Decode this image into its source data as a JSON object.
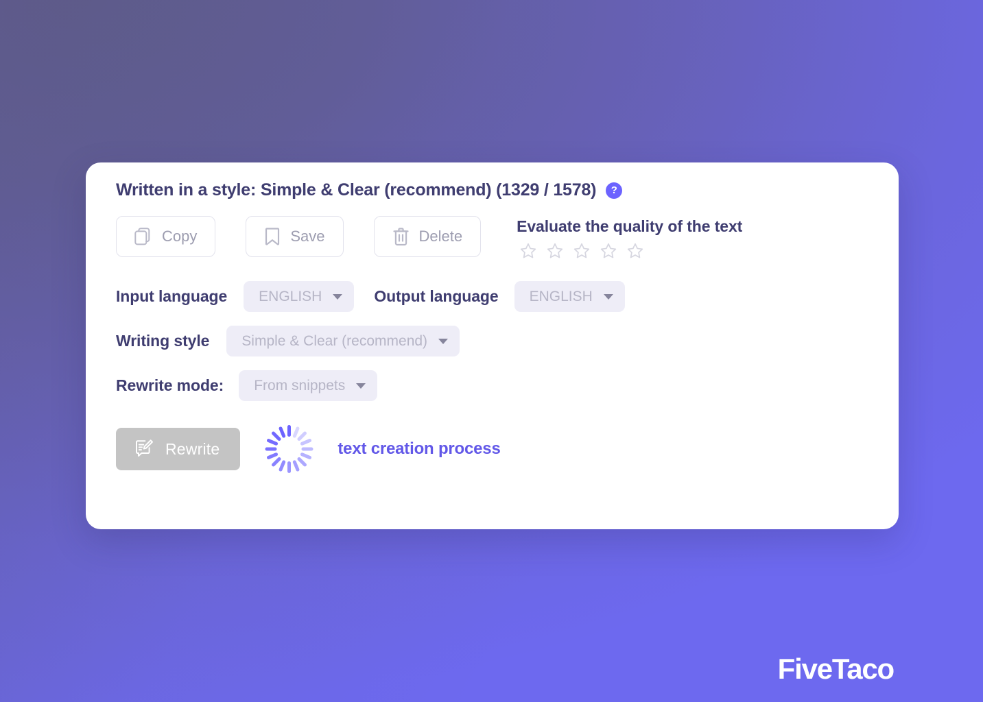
{
  "background": {
    "gradient_from": "#5e5b89",
    "gradient_to": "#6d69ef"
  },
  "card": {
    "heading": "Written in a style: Simple & Clear (recommend) (1329 / 1578)",
    "help_icon_glyph": "?",
    "accent_color": "#6c63ff",
    "heading_color": "#3f3d70"
  },
  "actions": [
    {
      "id": "copy",
      "label": "Copy",
      "icon": "copy-icon"
    },
    {
      "id": "save",
      "label": "Save",
      "icon": "bookmark-icon"
    },
    {
      "id": "delete",
      "label": "Delete",
      "icon": "trash-icon"
    }
  ],
  "evaluate": {
    "title": "Evaluate the quality of the text",
    "stars_total": 5,
    "stars_filled": 0,
    "star_color": "#d6d6e0"
  },
  "fields": {
    "input_language": {
      "label": "Input language",
      "value": "ENGLISH"
    },
    "output_language": {
      "label": "Output language",
      "value": "ENGLISH"
    },
    "writing_style": {
      "label": "Writing style",
      "value": "Simple & Clear (recommend)"
    },
    "rewrite_mode": {
      "label": "Rewrite mode:",
      "value": "From snippets"
    }
  },
  "bottom": {
    "rewrite_label": "Rewrite",
    "rewrite_icon": "edit-document-icon",
    "rewrite_button_color": "#c4c4c4",
    "spinner_icon": "loading-spinner-icon",
    "spinner_color": "#6c63ff",
    "status_text": "text creation process",
    "status_color": "#6258e8"
  },
  "watermark": {
    "text": "FiveTaco"
  }
}
